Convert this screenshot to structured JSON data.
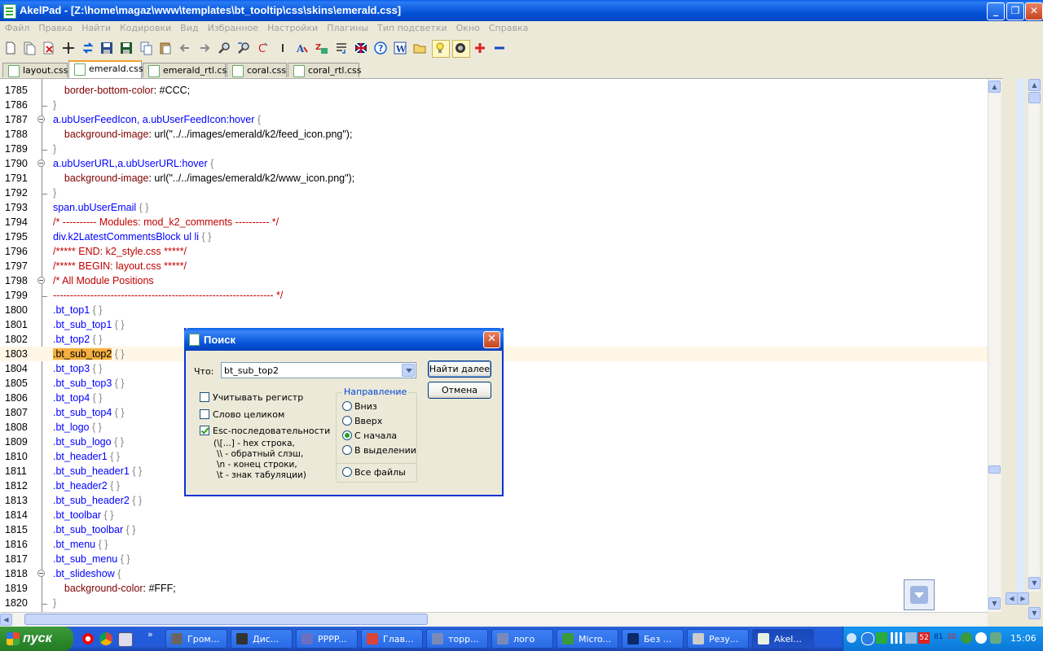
{
  "window": {
    "title": "AkelPad - [Z:\\home\\magaz\\www\\templates\\bt_tooltip\\css\\skins\\emerald.css]"
  },
  "menu": [
    "Файл",
    "Правка",
    "Найти",
    "Кодировки",
    "Вид",
    "Избранное",
    "Настройки",
    "Плагины",
    "Тип подсветки",
    "Окно",
    "Справка"
  ],
  "tabs": [
    {
      "label": "layout.css",
      "active": false
    },
    {
      "label": "emerald.css",
      "active": true
    },
    {
      "label": "emerald_rtl.css",
      "active": false
    },
    {
      "label": "coral.css",
      "active": false
    },
    {
      "label": "coral_rtl.css",
      "active": false
    }
  ],
  "editor": {
    "lines": [
      {
        "n": "1785",
        "parts": [
          [
            "    ",
            "val"
          ],
          [
            "border-bottom-color",
            "prop"
          ],
          [
            ": #CCC;",
            "val"
          ]
        ],
        "fold": "none"
      },
      {
        "n": "1786",
        "parts": [
          [
            "}",
            "brace"
          ]
        ],
        "fold": "end"
      },
      {
        "n": "1787",
        "parts": [
          [
            "a.ubUserFeedIcon, a.ubUserFeedIcon:hover ",
            "sel"
          ],
          [
            "{",
            "brace"
          ]
        ],
        "fold": "start"
      },
      {
        "n": "1788",
        "parts": [
          [
            "    ",
            "val"
          ],
          [
            "background-image",
            "prop"
          ],
          [
            ": url(\"../../images/emerald/k2/feed_icon.png\");",
            "val"
          ]
        ],
        "fold": "none"
      },
      {
        "n": "1789",
        "parts": [
          [
            "}",
            "brace"
          ]
        ],
        "fold": "end"
      },
      {
        "n": "1790",
        "parts": [
          [
            "a.ubUserURL,a.ubUserURL:hover ",
            "sel"
          ],
          [
            "{",
            "brace"
          ]
        ],
        "fold": "start"
      },
      {
        "n": "1791",
        "parts": [
          [
            "    ",
            "val"
          ],
          [
            "background-image",
            "prop"
          ],
          [
            ": url(\"../../images/emerald/k2/www_icon.png\");",
            "val"
          ]
        ],
        "fold": "none"
      },
      {
        "n": "1792",
        "parts": [
          [
            "}",
            "brace"
          ]
        ],
        "fold": "end"
      },
      {
        "n": "1793",
        "parts": [
          [
            "span.ubUserEmail ",
            "sel"
          ],
          [
            "{ }",
            "brace"
          ]
        ],
        "fold": "none"
      },
      {
        "n": "1794",
        "parts": [
          [
            "/* ---------- Modules: mod_k2_comments ---------- */",
            "cmt"
          ]
        ],
        "fold": "none"
      },
      {
        "n": "1795",
        "parts": [
          [
            "div.k2LatestCommentsBlock ul li ",
            "sel"
          ],
          [
            "{ }",
            "brace"
          ]
        ],
        "fold": "none"
      },
      {
        "n": "1796",
        "parts": [
          [
            "/***** END: k2_style.css *****/",
            "cmt"
          ]
        ],
        "fold": "none"
      },
      {
        "n": "1797",
        "parts": [
          [
            "/***** BEGIN: layout.css *****/",
            "cmt"
          ]
        ],
        "fold": "none"
      },
      {
        "n": "1798",
        "parts": [
          [
            "/* All Module Positions",
            "cmt"
          ]
        ],
        "fold": "start"
      },
      {
        "n": "1799",
        "parts": [
          [
            "----------------------------------------------------------------- */",
            "cmt"
          ]
        ],
        "fold": "end"
      },
      {
        "n": "1800",
        "parts": [
          [
            ".bt_top1 ",
            "sel"
          ],
          [
            "{ }",
            "brace"
          ]
        ],
        "fold": "none"
      },
      {
        "n": "1801",
        "parts": [
          [
            ".bt_sub_top1 ",
            "sel"
          ],
          [
            "{ }",
            "brace"
          ]
        ],
        "fold": "none"
      },
      {
        "n": "1802",
        "parts": [
          [
            ".bt_top2 ",
            "sel"
          ],
          [
            "{ }",
            "brace"
          ]
        ],
        "fold": "none"
      },
      {
        "n": "1803",
        "parts": [
          [
            ".bt_sub_top2",
            "hl"
          ],
          [
            " ",
            "val"
          ],
          [
            "{ }",
            "brace"
          ]
        ],
        "fold": "none",
        "current": true
      },
      {
        "n": "1804",
        "parts": [
          [
            ".bt_top3 ",
            "sel"
          ],
          [
            "{ }",
            "brace"
          ]
        ],
        "fold": "none"
      },
      {
        "n": "1805",
        "parts": [
          [
            ".bt_sub_top3 ",
            "sel"
          ],
          [
            "{ }",
            "brace"
          ]
        ],
        "fold": "none"
      },
      {
        "n": "1806",
        "parts": [
          [
            ".bt_top4 ",
            "sel"
          ],
          [
            "{ }",
            "brace"
          ]
        ],
        "fold": "none"
      },
      {
        "n": "1807",
        "parts": [
          [
            ".bt_sub_top4 ",
            "sel"
          ],
          [
            "{ }",
            "brace"
          ]
        ],
        "fold": "none"
      },
      {
        "n": "1808",
        "parts": [
          [
            ".bt_logo ",
            "sel"
          ],
          [
            "{ }",
            "brace"
          ]
        ],
        "fold": "none"
      },
      {
        "n": "1809",
        "parts": [
          [
            ".bt_sub_logo ",
            "sel"
          ],
          [
            "{ }",
            "brace"
          ]
        ],
        "fold": "none"
      },
      {
        "n": "1810",
        "parts": [
          [
            ".bt_header1 ",
            "sel"
          ],
          [
            "{ }",
            "brace"
          ]
        ],
        "fold": "none"
      },
      {
        "n": "1811",
        "parts": [
          [
            ".bt_sub_header1 ",
            "sel"
          ],
          [
            "{ }",
            "brace"
          ]
        ],
        "fold": "none"
      },
      {
        "n": "1812",
        "parts": [
          [
            ".bt_header2 ",
            "sel"
          ],
          [
            "{ }",
            "brace"
          ]
        ],
        "fold": "none"
      },
      {
        "n": "1813",
        "parts": [
          [
            ".bt_sub_header2 ",
            "sel"
          ],
          [
            "{ }",
            "brace"
          ]
        ],
        "fold": "none"
      },
      {
        "n": "1814",
        "parts": [
          [
            ".bt_toolbar ",
            "sel"
          ],
          [
            "{ }",
            "brace"
          ]
        ],
        "fold": "none"
      },
      {
        "n": "1815",
        "parts": [
          [
            ".bt_sub_toolbar ",
            "sel"
          ],
          [
            "{ }",
            "brace"
          ]
        ],
        "fold": "none"
      },
      {
        "n": "1816",
        "parts": [
          [
            ".bt_menu ",
            "sel"
          ],
          [
            "{ }",
            "brace"
          ]
        ],
        "fold": "none"
      },
      {
        "n": "1817",
        "parts": [
          [
            ".bt_sub_menu ",
            "sel"
          ],
          [
            "{ }",
            "brace"
          ]
        ],
        "fold": "none"
      },
      {
        "n": "1818",
        "parts": [
          [
            ".bt_slideshow ",
            "sel"
          ],
          [
            "{",
            "brace"
          ]
        ],
        "fold": "start"
      },
      {
        "n": "1819",
        "parts": [
          [
            "    ",
            "val"
          ],
          [
            "background-color",
            "prop"
          ],
          [
            ": #FFF;",
            "val"
          ]
        ],
        "fold": "none"
      },
      {
        "n": "1820",
        "parts": [
          [
            "}",
            "brace"
          ]
        ],
        "fold": "end"
      }
    ]
  },
  "find_dialog": {
    "title": "Поиск",
    "what_label": "Что:",
    "what_value": "bt_sub_top2",
    "find_next": "Найти далее",
    "cancel": "Отмена",
    "match_case": "Учитывать регистр",
    "whole_word": "Слово целиком",
    "esc_seq": "Esc-последовательности",
    "esc_help": [
      "(\\[...] - hex строка,",
      "\\\\ - обратный слэш,",
      "\\n - конец строки,",
      "\\t - знак табуляции)"
    ],
    "direction_title": "Направление",
    "dir_down": "Вниз",
    "dir_up": "Вверх",
    "dir_begin": "С начала",
    "dir_selection": "В выделении",
    "all_files": "Все файлы",
    "checked": {
      "match_case": false,
      "whole_word": false,
      "esc_seq": true
    },
    "direction_selected": "dir_begin"
  },
  "taskbar": {
    "start": "пуск",
    "tasks": [
      "Гром...",
      "Дис...",
      "PPPP...",
      "Глав...",
      "торр...",
      "лого",
      "Micro...",
      "Без ...",
      "Резу...",
      "Akel..."
    ],
    "tray_numbers": [
      "52",
      "81",
      "20"
    ],
    "clock": "15:06"
  }
}
